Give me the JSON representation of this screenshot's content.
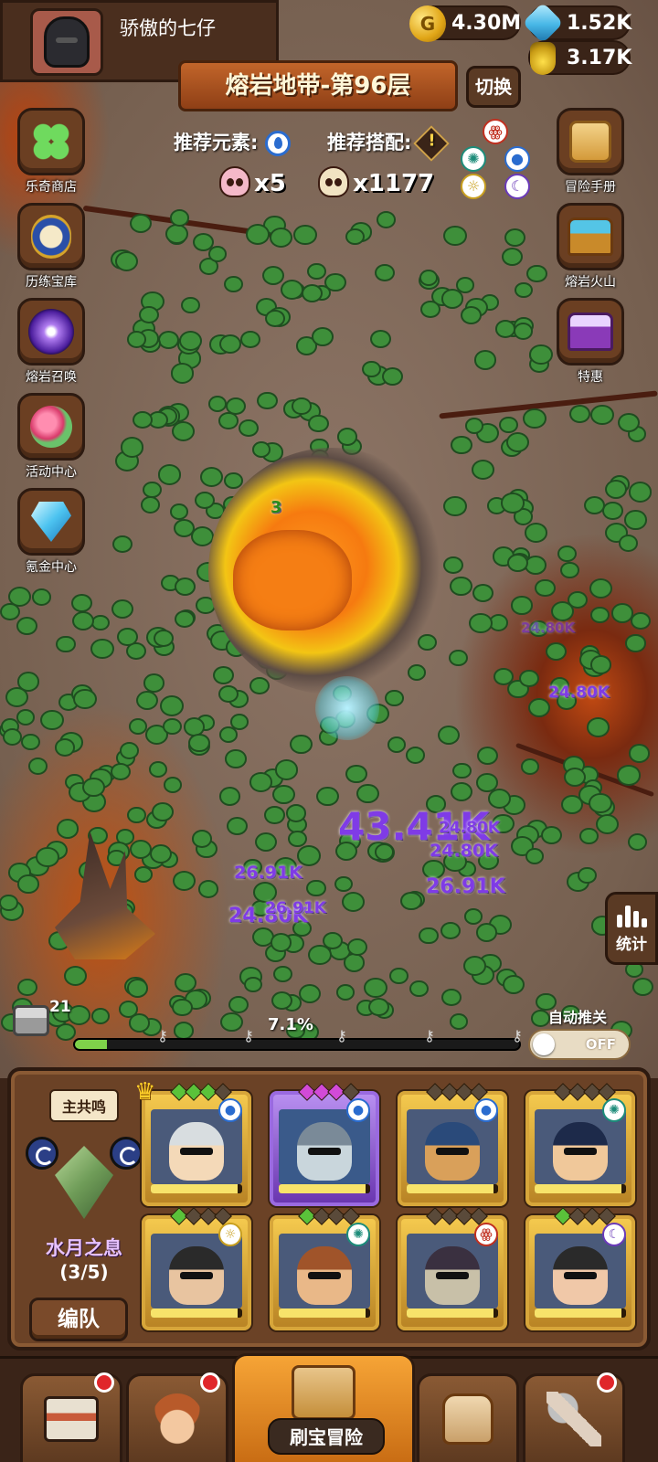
{
  "player": {
    "name": "骄傲的七仔"
  },
  "resources": {
    "gold": "4.30M",
    "gems": "1.52K",
    "potion": "3.17K"
  },
  "level": {
    "title": "熔岩地带-第96层",
    "switch_label": "切换"
  },
  "recommend": {
    "element_label": "推荐元素:",
    "combo_label": "推荐搭配:",
    "warn_symbol": "!"
  },
  "kills": {
    "elite": "x5",
    "normal": "x1177"
  },
  "left_menu": [
    {
      "label": "乐奇商店",
      "icon": "clover-icon"
    },
    {
      "label": "历练宝库",
      "icon": "book-icon"
    },
    {
      "label": "熔岩召唤",
      "icon": "portal-icon"
    },
    {
      "label": "活动中心",
      "icon": "flower-icon"
    },
    {
      "label": "氪金中心",
      "icon": "diamond-icon"
    }
  ],
  "right_menu": [
    {
      "label": "冒险手册",
      "icon": "scroll-icon"
    },
    {
      "label": "熔岩火山",
      "icon": "chest-icon"
    },
    {
      "label": "特惠",
      "icon": "purple-chest-icon"
    }
  ],
  "battle": {
    "damage_numbers": [
      "43.41K",
      "26.91K",
      "24.80K",
      "26.91K",
      "24.80K",
      "26.91K",
      "24.80K",
      "24.80K",
      "24.80K"
    ],
    "hit_counter": "3"
  },
  "stats_label": "统计",
  "progress": {
    "chest_count": "21",
    "percent_label": "7.1%",
    "fraction": 0.071
  },
  "auto_push": {
    "label": "自动推关",
    "state": "OFF"
  },
  "team": {
    "resonance_label": "主共鸣",
    "resonance_name": "水月之息",
    "resonance_count": "(3/5)",
    "formation_label": "编队",
    "heroes": [
      {
        "element": "water",
        "stars": 3,
        "health": 0.95,
        "selected": false,
        "crown": true
      },
      {
        "element": "water",
        "stars": 3,
        "health": 0.95,
        "selected": true,
        "crown": false
      },
      {
        "element": "water",
        "stars": 0,
        "health": 0.95,
        "selected": false,
        "crown": false
      },
      {
        "element": "wind",
        "stars": 0,
        "health": 0.95,
        "selected": false,
        "crown": false
      },
      {
        "element": "light",
        "stars": 1,
        "health": 0.95,
        "selected": false,
        "crown": false
      },
      {
        "element": "wind",
        "stars": 1,
        "health": 0.95,
        "selected": false,
        "crown": false
      },
      {
        "element": "fire",
        "stars": 0,
        "health": 0.95,
        "selected": false,
        "crown": false
      },
      {
        "element": "moon",
        "stars": 1,
        "health": 0.95,
        "selected": false,
        "crown": false
      }
    ]
  },
  "bottom_nav": {
    "active_label": "刷宝冒险"
  },
  "colors": {
    "panel_brown": "#6b4226",
    "accent_orange": "#f6a436",
    "damage_purple": "#7f3be6",
    "progress_green": "#7fd14a"
  }
}
